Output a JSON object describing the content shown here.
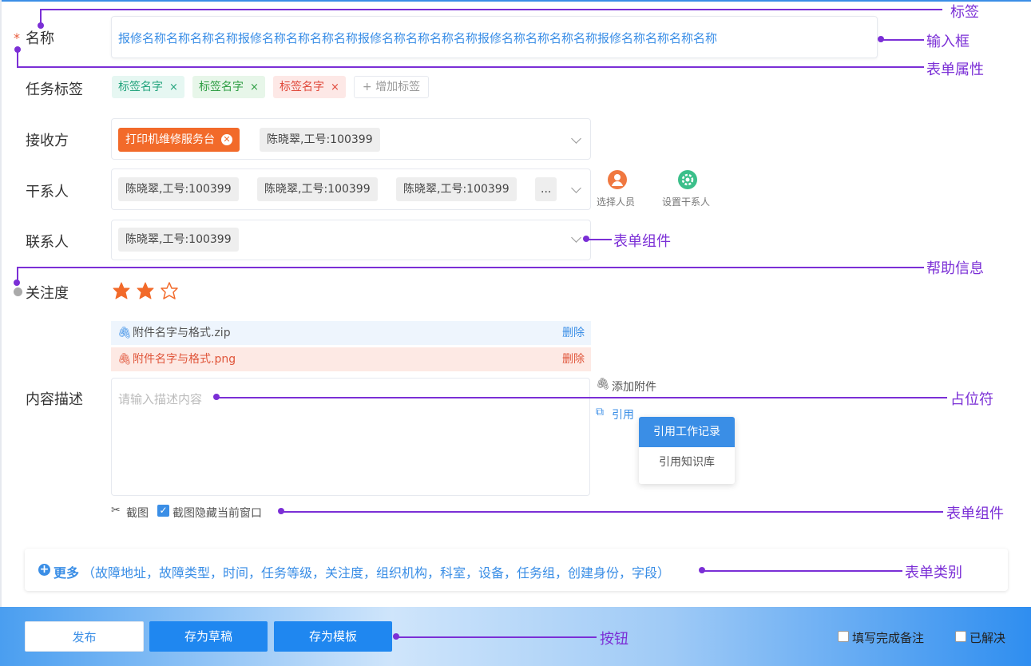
{
  "form": {
    "name": {
      "label": "名称",
      "required_mark": "*",
      "value": "报修名称名称名称名称报修名称名称名称名称报修名称名称名称名称报修名称名称名称名称报修名称名称名称名称"
    },
    "tags": {
      "label": "任务标签",
      "items": [
        {
          "text": "标签名字",
          "close": "×",
          "bg": "#e6f7f2",
          "color": "#22a37c"
        },
        {
          "text": "标签名字",
          "close": "×",
          "bg": "#e7f6e9",
          "color": "#2f9e44"
        },
        {
          "text": "标签名字",
          "close": "×",
          "bg": "#fde8e6",
          "color": "#e0483a"
        }
      ],
      "add_label": "+ 增加标签"
    },
    "receiver": {
      "label": "接收方",
      "orange_chip": "打印机维修服务台",
      "chip": "陈晓翠,工号:100399"
    },
    "stakeholders": {
      "label": "干系人",
      "chips": [
        "陈晓翠,工号:100399",
        "陈晓翠,工号:100399",
        "陈晓翠,工号:100399"
      ],
      "more": "...",
      "select_person": "选择人员",
      "set_stakeholder": "设置干系人"
    },
    "contact": {
      "label": "联系人",
      "chip": "陈晓翠,工号:100399"
    },
    "attention": {
      "label": "关注度",
      "rating": 2,
      "max": 5,
      "stars_shown": 3
    },
    "attachments": [
      {
        "name": "附件名字与格式.zip",
        "delete": "删除",
        "bg": "#eef5fd",
        "color": "#555",
        "del_color": "#3a8ee6"
      },
      {
        "name": "附件名字与格式.png",
        "delete": "删除",
        "bg": "#fde9e4",
        "color": "#e0553a",
        "del_color": "#e0553a"
      }
    ],
    "description": {
      "label": "内容描述",
      "placeholder": "请输入描述内容"
    },
    "add_attachment": "添加附件",
    "cite": "引用",
    "cite_menu": [
      "引用工作记录",
      "引用知识库"
    ],
    "screenshot": "截图",
    "hide_window": "截图隐藏当前窗口",
    "more": {
      "title": "更多",
      "fields": "（故障地址，故障类型，时间，任务等级，关注度，组织机构，科室，设备，任务组，创建身份，字段）"
    }
  },
  "footer": {
    "publish": "发布",
    "save_draft": "存为草稿",
    "save_template": "存为模板",
    "fill_note": "填写完成备注",
    "resolved": "已解决"
  },
  "annotations": {
    "label": "标签",
    "input": "输入框",
    "form_attr": "表单属性",
    "form_component": "表单组件",
    "help_info": "帮助信息",
    "placeholder": "占位符",
    "form_component2": "表单组件",
    "form_category": "表单类别",
    "button": "按钮"
  },
  "colors": {
    "accent": "#3a8ee6",
    "orange": "#f26a2a",
    "annotation": "#7b2fd6"
  }
}
